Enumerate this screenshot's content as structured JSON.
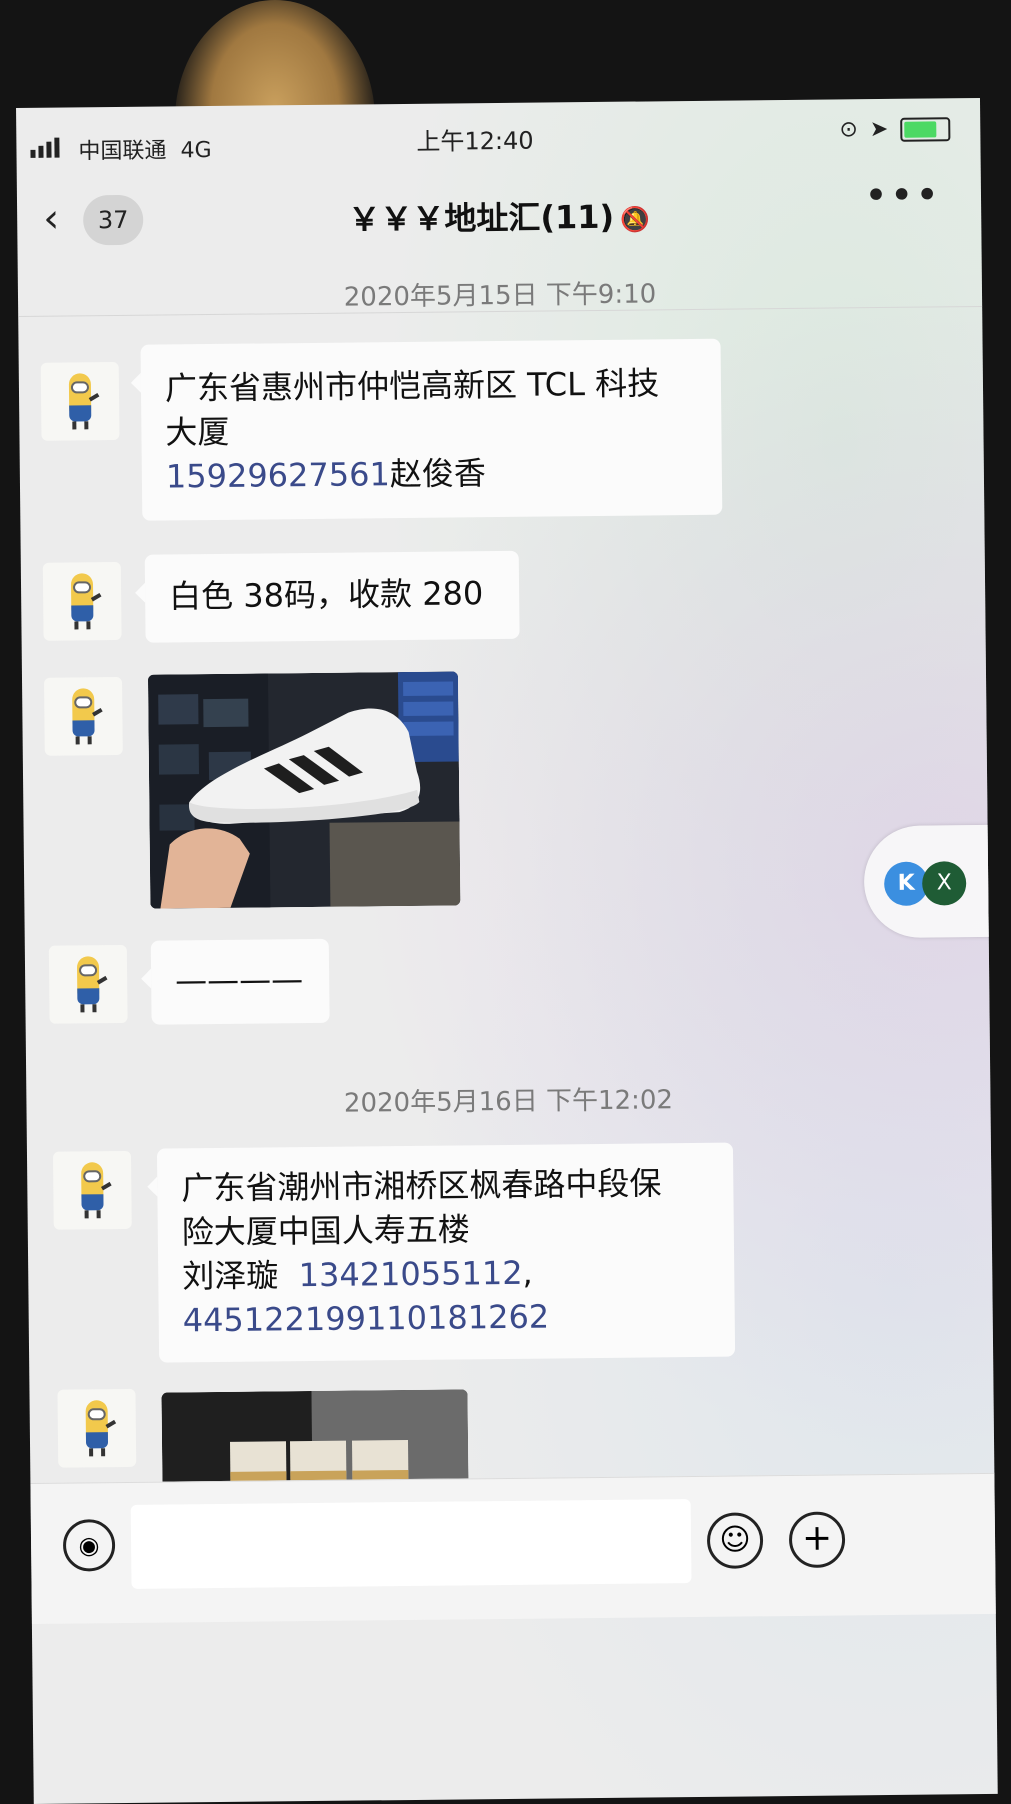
{
  "status_bar": {
    "carrier": "中国联通",
    "network": "4G",
    "time": "上午12:40"
  },
  "nav": {
    "unread_count": "37",
    "title": "￥￥￥地址汇(11)",
    "more": "•••"
  },
  "messages": {
    "timestamp1": "2020年5月15日 下午9:10",
    "msg1": {
      "line1": "广东省惠州市仲恺高新区 TCL 科技",
      "line2": "大厦",
      "phone": "15929627561",
      "name": "赵俊香"
    },
    "msg2": {
      "text": "白色 38码，收款 280"
    },
    "msg4": {
      "text": "————"
    },
    "timestamp2": "2020年5月16日 下午12:02",
    "msg5": {
      "line1": "广东省潮州市湘桥区枫春路中段保",
      "line2": "险大厦中国人寿五楼",
      "name": "刘泽璇",
      "phone": "13421055112",
      "comma": ",",
      "id_number": "445122199110181262"
    }
  },
  "float_widget": {
    "k_label": "K",
    "x_label": "X"
  },
  "input_bar": {
    "voice_glyph": "◉",
    "emoji_glyph": "☺",
    "plus_glyph": "+"
  },
  "colors": {
    "accent_link": "#3a4a8a",
    "chat_background": "#ececec",
    "bubble": "#fbfbfb"
  }
}
